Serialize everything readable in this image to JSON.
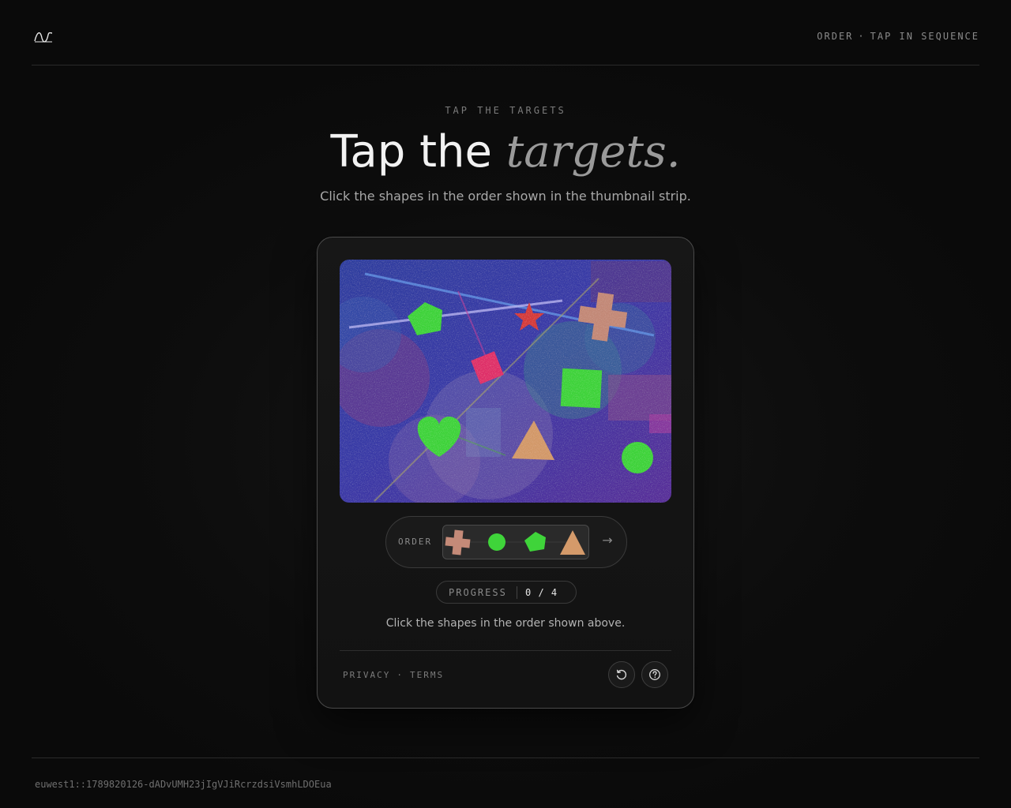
{
  "header": {
    "logo_icon": "wave-logo-icon",
    "mode_label": "ORDER",
    "separator": "·",
    "mode_hint": "TAP IN SEQUENCE"
  },
  "hero": {
    "eyebrow": "TAP THE TARGETS",
    "title_plain": "Tap the ",
    "title_emphasis": "targets.",
    "subtitle": "Click the shapes in the order shown in the thumbnail strip."
  },
  "challenge": {
    "canvas_shapes": [
      "pentagon",
      "star",
      "cross",
      "diamond",
      "square",
      "heart",
      "triangle",
      "circle"
    ],
    "order_label": "ORDER",
    "order_sequence": [
      "cross",
      "circle",
      "pentagon",
      "triangle"
    ],
    "order_arrow_icon": "arrow-right-icon",
    "progress_label": "PROGRESS",
    "progress_value": "0 / 4",
    "progress_current": 0,
    "progress_total": 4,
    "instruction": "Click the shapes in the order shown above."
  },
  "card_footer": {
    "privacy": "PRIVACY",
    "separator": "·",
    "terms": "TERMS",
    "refresh_icon": "refresh-icon",
    "help_icon": "help-icon"
  },
  "footer": {
    "session_id": "euwest1::1789820126-dADvUMH23jIgVJiRcrzdsiVsmhLDOEua"
  },
  "colors": {
    "background": "#0b0b0b",
    "green_shape": "#3fd43a",
    "salmon_shape": "#c48a78",
    "pink_shape": "#e0306a",
    "red_star": "#d63a3a",
    "tan_triangle": "#d49a6a"
  }
}
